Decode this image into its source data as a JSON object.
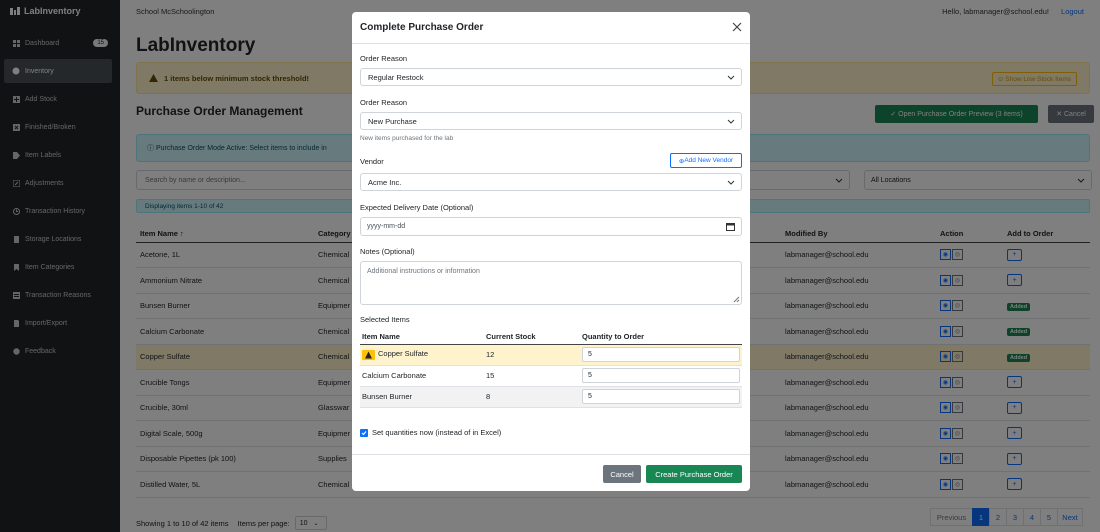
{
  "app": {
    "brand": "LabInventory"
  },
  "sidebar": {
    "items": [
      {
        "label": "Dashboard",
        "badge": "15",
        "icon": "grid-icon"
      },
      {
        "label": "Inventory",
        "icon": "box-icon",
        "active": true
      },
      {
        "label": "Add Stock",
        "icon": "plus-square-icon"
      },
      {
        "label": "Finished/Broken",
        "icon": "x-square-icon"
      },
      {
        "label": "Item Labels",
        "icon": "tag-icon"
      },
      {
        "label": "Adjustments",
        "icon": "pencil-icon"
      },
      {
        "label": "Transaction History",
        "icon": "history-icon"
      },
      {
        "label": "Storage Locations",
        "icon": "building-icon"
      },
      {
        "label": "Item Categories",
        "icon": "bookmark-icon"
      },
      {
        "label": "Transaction Reasons",
        "icon": "list-icon"
      },
      {
        "label": "Import/Export",
        "icon": "file-icon"
      },
      {
        "label": "Feedback",
        "icon": "chat-icon"
      }
    ]
  },
  "topbar": {
    "school": "School McSchoolington",
    "greeting": "Hello, labmanager@school.edu!",
    "logout": "Logout"
  },
  "page": {
    "title": "LabInventory",
    "low_stock_alert": "1 items below minimum stock threshold!",
    "show_low_stock": "Show Low Stock Items",
    "section_title": "Purchase Order Management",
    "open_po_button": "Open Purchase Order Preview (3 items)",
    "cancel_button": "Cancel",
    "po_mode_info": "ⓘ Purchase Order Mode Active: Select items to include in",
    "search_placeholder": "Search by name or description...",
    "location_filter": "All Locations",
    "displaying": "Displaying items 1-10 of 42"
  },
  "table": {
    "columns": {
      "name": "Item Name ↑",
      "category": "Category",
      "modified_by": "Modified By",
      "action": "Action",
      "add": "Add to Order"
    },
    "rows": [
      {
        "name": "Acetone, 1L",
        "category": "Chemical",
        "modified_by": "labmanager@school.edu",
        "added": false
      },
      {
        "name": "Ammonium Nitrate",
        "category": "Chemical",
        "modified_by": "labmanager@school.edu",
        "added": false
      },
      {
        "name": "Bunsen Burner",
        "category": "Equipmer",
        "modified_by": "labmanager@school.edu",
        "added": true
      },
      {
        "name": "Calcium Carbonate",
        "category": "Chemical",
        "modified_by": "labmanager@school.edu",
        "added": true
      },
      {
        "name": "Copper Sulfate",
        "category": "Chemical",
        "modified_by": "labmanager@school.edu",
        "added": true,
        "highlight": true
      },
      {
        "name": "Crucible Tongs",
        "category": "Equipmer",
        "modified_by": "labmanager@school.edu",
        "added": false
      },
      {
        "name": "Crucible, 30ml",
        "category": "Glasswar",
        "modified_by": "labmanager@school.edu",
        "added": false
      },
      {
        "name": "Digital Scale, 500g",
        "category": "Equipmer",
        "modified_by": "labmanager@school.edu",
        "added": false
      },
      {
        "name": "Disposable Pipettes (pk 100)",
        "category": "Supplies",
        "modified_by": "labmanager@school.edu",
        "added": false
      },
      {
        "name": "Distilled Water, 5L",
        "category": "Chemical",
        "modified_by": "labmanager@school.edu",
        "added": false
      }
    ],
    "added_label": "Added",
    "add_label": "+"
  },
  "footer": {
    "showing": "Showing 1 to 10 of 42 items",
    "per_page_label": "Items per page:",
    "per_page_value": "10",
    "pagination": {
      "prev": "Previous",
      "pages": [
        "1",
        "2",
        "3",
        "4",
        "5"
      ],
      "next": "Next",
      "active": "1"
    }
  },
  "modal": {
    "title": "Complete Purchase Order",
    "order_reason_label_1": "Order Reason",
    "order_reason_value_1": "Regular Restock",
    "order_reason_label_2": "Order Reason",
    "order_reason_value_2": "New Purchase",
    "order_reason_help": "New items purchased for the lab",
    "vendor_label": "Vendor",
    "add_vendor": "Add New Vendor",
    "vendor_value": "Acme Inc.",
    "delivery_label": "Expected Delivery Date (Optional)",
    "delivery_placeholder": "yyyy-mm-dd",
    "notes_label": "Notes (Optional)",
    "notes_placeholder": "Additional instructions or information",
    "selected_items_label": "Selected Items",
    "selected_columns": {
      "name": "Item Name",
      "stock": "Current Stock",
      "qty": "Quantity to Order"
    },
    "selected_items": [
      {
        "name": "Copper Sulfate",
        "stock": "12",
        "qty": "5",
        "warning": true
      },
      {
        "name": "Calcium Carbonate",
        "stock": "15",
        "qty": "5"
      },
      {
        "name": "Bunsen Burner",
        "stock": "8",
        "qty": "5"
      }
    ],
    "set_quantities_label": "Set quantities now (instead of in Excel)",
    "cancel": "Cancel",
    "create": "Create Purchase Order"
  },
  "colors": {
    "primary": "#0d6efd",
    "success": "#198754",
    "secondary": "#6c757d",
    "warning_bg": "#fff3cd",
    "info_bg": "#cff4fc",
    "sidebar_bg": "#212529"
  }
}
